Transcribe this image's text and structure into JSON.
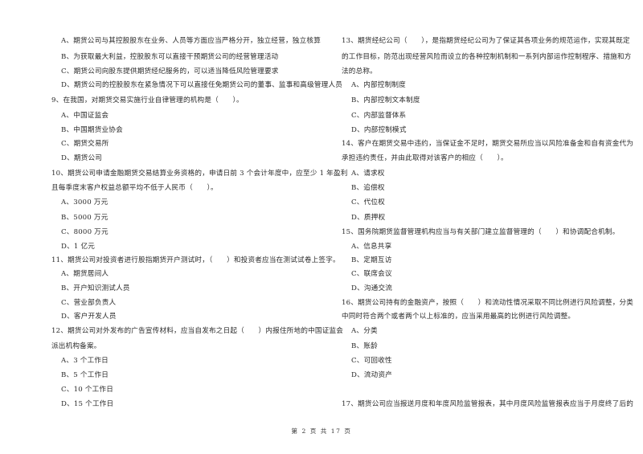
{
  "left_column": [
    {
      "type": "option",
      "text": "A、期货公司与其控股股东在业务、人员等方面应当严格分开，独立经营，独立核算"
    },
    {
      "type": "option",
      "text": "B、为获取最大利益，控股股东可以直接干预期货公司的经营管理活动"
    },
    {
      "type": "option",
      "text": "C、期货公司向股东提供期货经纪服务的，可以适当降低风险管理要求"
    },
    {
      "type": "option",
      "text": "D、期货公司的控股股东在紧急情况下可以直接任免期货公司的董事、监事和高级管理人员"
    },
    {
      "type": "question",
      "text": "9、在我国，对期货交易实施行业自律管理的机构是（　　）。"
    },
    {
      "type": "option",
      "text": "A、中国证监会"
    },
    {
      "type": "option",
      "text": "B、中国期货业协会"
    },
    {
      "type": "option",
      "text": "C、期货交易所"
    },
    {
      "type": "option",
      "text": "D、期货公司"
    },
    {
      "type": "question",
      "text": "10、期货公司申请金融期货交易结算业务资格的，申请日前 3 个会计年度中，应至少 1 年盈利"
    },
    {
      "type": "question",
      "text": "且每季度末客户权益总额平均不低于人民币（　　）。"
    },
    {
      "type": "option",
      "text": "A、3000 万元"
    },
    {
      "type": "option",
      "text": "B、5000 万元"
    },
    {
      "type": "option",
      "text": "C、8000 万元"
    },
    {
      "type": "option",
      "text": "D、1 亿元"
    },
    {
      "type": "question",
      "text": "11、期货公司对投资者进行股指期货开户测试时，（　　）和投资者应当在测试试卷上签字。"
    },
    {
      "type": "option",
      "text": "A、期货居间人"
    },
    {
      "type": "option",
      "text": "B、开户知识测试人员"
    },
    {
      "type": "option",
      "text": "C、营业部负责人"
    },
    {
      "type": "option",
      "text": "D、客户开发人员"
    },
    {
      "type": "question",
      "text": "12、期货公司对外发布的广告宣传材料，应当自发布之日起（　　）内报住所地的中国证监会"
    },
    {
      "type": "question",
      "text": "派出机构备案。"
    },
    {
      "type": "option",
      "text": "A、3 个工作日"
    },
    {
      "type": "option",
      "text": "B、5 个工作日"
    },
    {
      "type": "option",
      "text": "C、10 个工作日"
    },
    {
      "type": "option",
      "text": "D、15 个工作日"
    }
  ],
  "right_column": [
    {
      "type": "question",
      "text": "13、期货经纪公司（　　），是指期货经纪公司为了保证其各项业务的规范运作，实现其既定"
    },
    {
      "type": "question",
      "text": "的工作目标，防范出现经营风险而设立的各种控制机制和一系列内部运作控制程序、措施和方"
    },
    {
      "type": "question",
      "text": "法的总称。"
    },
    {
      "type": "option",
      "text": "A、内部控制制度"
    },
    {
      "type": "option",
      "text": "B、内部控制文本制度"
    },
    {
      "type": "option",
      "text": "C、内部监督体系"
    },
    {
      "type": "option",
      "text": "D、内部控制模式"
    },
    {
      "type": "question",
      "text": "14、客户在期货交易中违约，当保证金不足时，期货交易所应当以风险准备金和自有资金代为"
    },
    {
      "type": "question",
      "text": "承担违约责任，并由此取得对该客户的相应（　　）。"
    },
    {
      "type": "option",
      "text": "A、请求权"
    },
    {
      "type": "option",
      "text": "B、追偿权"
    },
    {
      "type": "option",
      "text": "C、代位权"
    },
    {
      "type": "option",
      "text": "D、质押权"
    },
    {
      "type": "question",
      "text": "15、国务院期货监督管理机构应当与有关部门建立监督管理的（　　）和协调配合机制。"
    },
    {
      "type": "option",
      "text": "A、信息共享"
    },
    {
      "type": "option",
      "text": "B、定期互访"
    },
    {
      "type": "option",
      "text": "C、联席会议"
    },
    {
      "type": "option",
      "text": "D、沟通交流"
    },
    {
      "type": "question",
      "text": "16、期货公司持有的金融资产，按照（　　）和流动性情况采取不同比例进行风险调整，分类"
    },
    {
      "type": "question",
      "text": "中同时符合两个或者两个以上标准的，应当采用最高的比例进行风险调整。"
    },
    {
      "type": "option",
      "text": "A、分类"
    },
    {
      "type": "option",
      "text": "B、账龄"
    },
    {
      "type": "option",
      "text": "C、可回收性"
    },
    {
      "type": "option",
      "text": "D、流动资产"
    },
    {
      "type": "question",
      "text": "17、期货公司应当报送月度和年度风险监管报表，其中月度风险监管报表应当于月度终了后的"
    }
  ],
  "footer": {
    "page_label": "第 2 页 共 17 页"
  }
}
